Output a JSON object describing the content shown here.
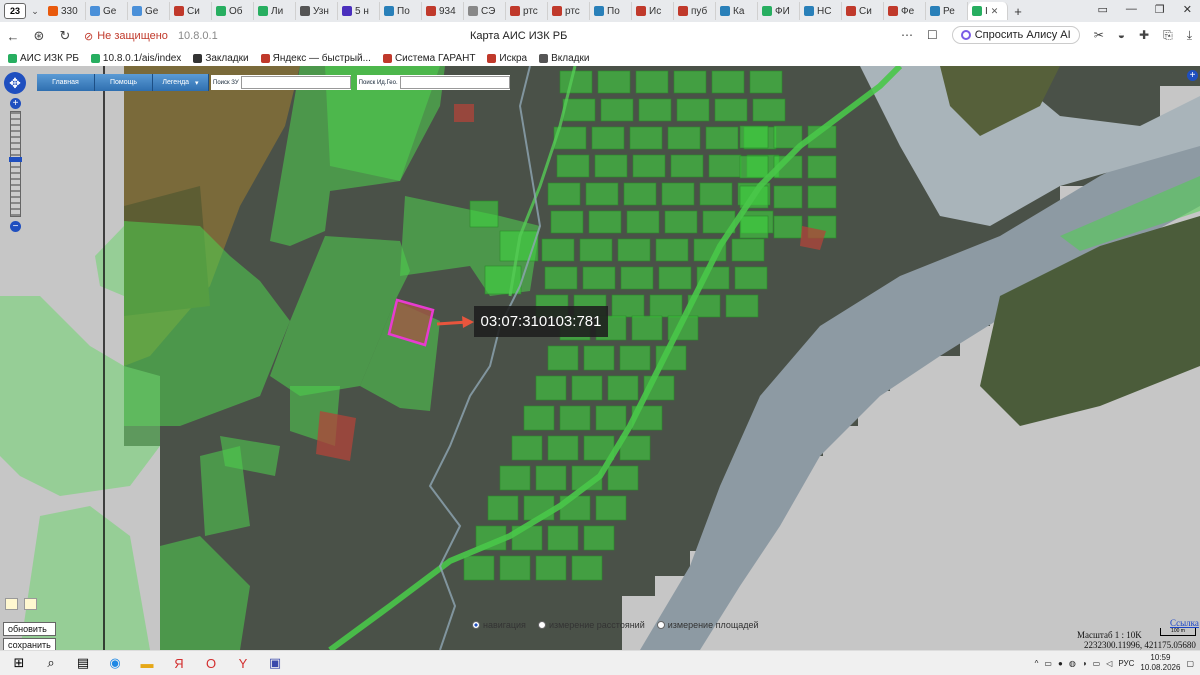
{
  "browser": {
    "tab_count": "23",
    "tabs": [
      {
        "label": "330",
        "color": "#e8590c"
      },
      {
        "label": "Ge",
        "color": "#4a90d9"
      },
      {
        "label": "Ge",
        "color": "#4a90d9"
      },
      {
        "label": "Си",
        "color": "#c0392b"
      },
      {
        "label": "Об",
        "color": "#27ae60"
      },
      {
        "label": "Ли",
        "color": "#27ae60"
      },
      {
        "label": "Узн",
        "color": "#555555"
      },
      {
        "label": "5 н",
        "color": "#4a2fbd"
      },
      {
        "label": "По",
        "color": "#2980b9"
      },
      {
        "label": "934",
        "color": "#c0392b"
      },
      {
        "label": "СЭ",
        "color": "#888888"
      },
      {
        "label": "ртс",
        "color": "#c0392b"
      },
      {
        "label": "ртс",
        "color": "#c0392b"
      },
      {
        "label": "По",
        "color": "#2980b9"
      },
      {
        "label": "Ис",
        "color": "#c0392b"
      },
      {
        "label": "пуб",
        "color": "#c0392b"
      },
      {
        "label": "Ка",
        "color": "#2980b9"
      },
      {
        "label": "ФИ",
        "color": "#27ae60"
      },
      {
        "label": "НС",
        "color": "#2980b9"
      },
      {
        "label": "Си",
        "color": "#c0392b"
      },
      {
        "label": "Фе",
        "color": "#c0392b"
      },
      {
        "label": "Ре",
        "color": "#2980b9"
      }
    ],
    "active_tab": {
      "label": "I",
      "color": "#27ae60"
    },
    "insecure_label": "Не защищено",
    "url_host": "10.8.0.1",
    "page_title": "Карта АИС ИЗК РБ",
    "alice_label": "Спросить Алису AI",
    "bookmarks": [
      {
        "label": "АИС ИЗК РБ",
        "color": "#27ae60"
      },
      {
        "label": "10.8.0.1/ais/index",
        "color": "#27ae60"
      },
      {
        "label": "Закладки",
        "color": "#333333"
      },
      {
        "label": "Яндекс — быстрый...",
        "color": "#c0392b"
      },
      {
        "label": "Система ГАРАНТ",
        "color": "#c0392b"
      },
      {
        "label": "Искра",
        "color": "#c0392b"
      },
      {
        "label": "Вкладки",
        "color": "#555555"
      }
    ]
  },
  "map": {
    "menu": {
      "home": "Главная",
      "help": "Помощь",
      "legend": "Легенда"
    },
    "search_zu_label": "Поиск ЗУ",
    "search_geo_label": "Поиск Ид.Гео.",
    "cadastral_label": "03:07:310103:781",
    "modes": [
      "навигация",
      "измерение расстояний",
      "измерение площадей"
    ],
    "active_mode": 0,
    "link_label": "Ссылка",
    "scale_label": "Масштаб 1 : 10K",
    "scale_bar_label": "100 m",
    "coords": "2232300.11996, 421175.05680",
    "refresh_label": "обновить",
    "save_label": "сохранить",
    "zoom_level_fraction": 0.45
  },
  "taskbar": {
    "lang": "РУС",
    "time": "10:59",
    "date": "10.08.2026"
  }
}
